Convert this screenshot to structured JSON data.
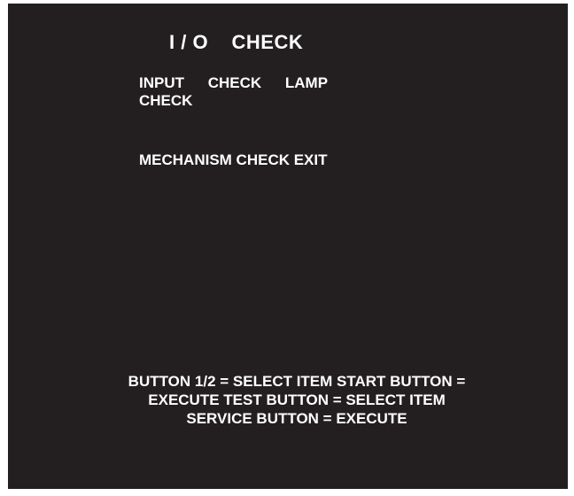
{
  "screen": {
    "title": "I / O    CHECK",
    "menu_item_1": "INPUT CHECK LAMP CHECK",
    "menu_item_2": "MECHANISM CHECK EXIT",
    "instructions": "BUTTON 1/2 = SELECT ITEM START BUTTON = EXECUTE TEST BUTTON = SELECT ITEM SERVICE BUTTON = EXECUTE",
    "background_color": "#231f20",
    "text_color": "#ffffff"
  }
}
